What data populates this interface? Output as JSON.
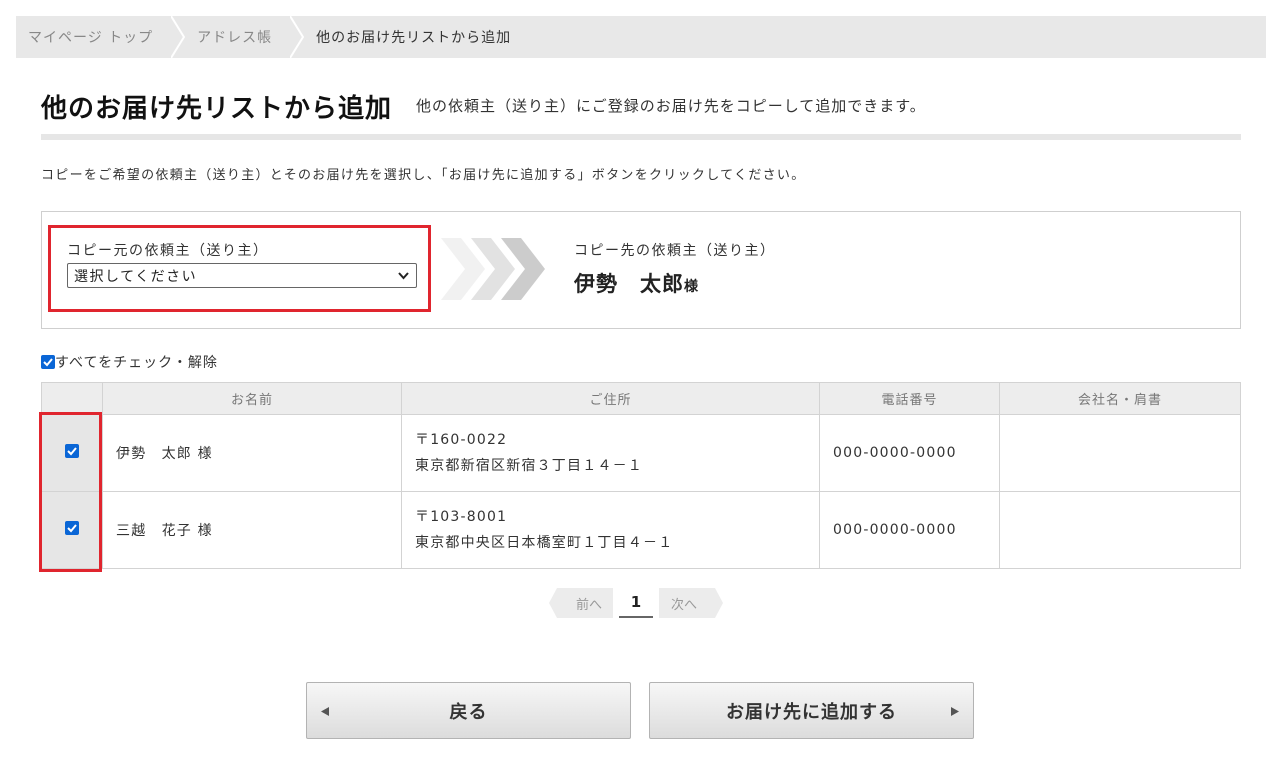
{
  "breadcrumb": {
    "items": [
      "マイページ トップ",
      "アドレス帳",
      "他のお届け先リストから追加"
    ]
  },
  "page": {
    "title": "他のお届け先リストから追加",
    "subtitle": "他の依頼主（送り主）にご登録のお届け先をコピーして追加できます。",
    "instruction": "コピーをご希望の依頼主（送り主）とそのお届け先を選択し、「お届け先に追加する」ボタンをクリックしてください。"
  },
  "copy_panel": {
    "source_label": "コピー元の依頼主（送り主）",
    "source_select_value": "選択してください",
    "dest_label": "コピー先の依頼主（送り主）",
    "dest_name": "伊勢　太郎",
    "dest_suffix": "様"
  },
  "check_all": {
    "label": "すべてをチェック・解除",
    "checked": true
  },
  "table": {
    "headers": [
      "",
      "お名前",
      "ご住所",
      "電話番号",
      "会社名・肩書"
    ],
    "rows": [
      {
        "checked": true,
        "name": "伊勢　太郎 様",
        "postal": "〒160-0022",
        "address": "東京都新宿区新宿３丁目１４－１",
        "phone": "000-0000-0000",
        "company": ""
      },
      {
        "checked": true,
        "name": "三越　花子 様",
        "postal": "〒103-8001",
        "address": "東京都中央区日本橋室町１丁目４－１",
        "phone": "000-0000-0000",
        "company": ""
      }
    ]
  },
  "pager": {
    "prev": "前へ",
    "current": "1",
    "next": "次へ"
  },
  "actions": {
    "back_label": "戻る",
    "add_label": "お届け先に追加する"
  },
  "colors": {
    "highlight": "#e0252e",
    "checkbox": "#0a66d6",
    "breadcrumb_bg": "#e8e8e8"
  }
}
